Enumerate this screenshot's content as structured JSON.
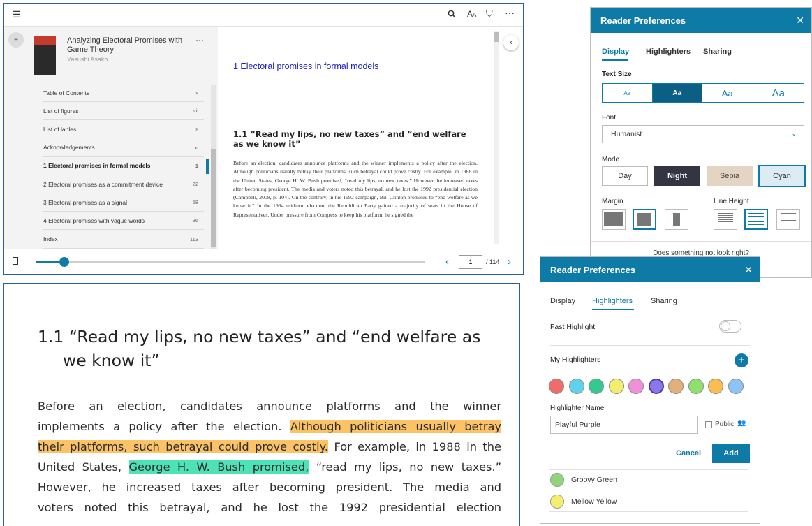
{
  "reader": {
    "book_title": "Analyzing Electoral Promises with Game Theory",
    "author": "Yasushi Asako",
    "toc": [
      {
        "label": "Table of Contents",
        "page": "v"
      },
      {
        "label": "List of figures",
        "page": "vii"
      },
      {
        "label": "List of lables",
        "page": "ix"
      },
      {
        "label": "Acknowledgements",
        "page": "xi"
      },
      {
        "label": "1 Electoral promises in formal models",
        "page": "1"
      },
      {
        "label": "2 Electoral promises as a commitment device",
        "page": "22"
      },
      {
        "label": "3 Electoral promises as a signal",
        "page": "58"
      },
      {
        "label": "4 Electoral promises with vague words",
        "page": "96"
      },
      {
        "label": "Index",
        "page": "113"
      }
    ],
    "active_toc_index": 4,
    "chapter_title": "1 Electoral promises in formal models",
    "section_title": "1.1 “Read my lips, no new taxes” and “end welfare as we know it”",
    "body_text": "Before an election, candidates announce platforms and the winner implements a policy after the election. Although politicians usually betray their platforms, such betrayal could prove costly. For example, in 1988 in the United States, George H. W. Bush promised, “read my lips, no new taxes.” However, he increased taxes after becoming president. The media and voters noted this betrayal, and he lost the 1992 presidential election (Campbell, 2008, p. 104). On the contrary, in his 1992 campaign, Bill Clinton promised to “end welfare as we know it.” In the 1994 midterm election, the Republican Party gained a majority of seats in the House of Representatives. Under pressure from Congress to keep his platform, he signed the",
    "page_current": "1",
    "page_total": "/ 114",
    "progress": 0.009,
    "icons": {
      "menu": "menu-lines-icon",
      "search": "search-icon",
      "text": "text-size-icon",
      "bookmark_add": "bookmark-star-icon",
      "more": "more-icon",
      "bookmark": "bookmark-icon"
    }
  },
  "zoom": {
    "heading_line1": "1.1 “Read my lips, no new taxes” and “end welfare as",
    "heading_line2": "we know it”",
    "l1": "Before an election, candidates announce platforms and the winner",
    "l2_a": "implements a policy after the election. ",
    "l2_b": "Although politicians usually betray",
    "l3_a": "their platforms, such betrayal could prove costly.",
    "l3_b": " For example, in 1988 in the",
    "l4_a": "United States, ",
    "l4_b": "George H. W. Bush promised,",
    "l4_c": " “read my lips, no new taxes.”",
    "l5": "However, he increased taxes after becoming president. The media and",
    "l6": "voters noted this betrayal, and he lost the 1992 presidential election",
    "colors": {
      "orange": "#fbc365",
      "green": "#4de3b7"
    }
  },
  "prefs_display": {
    "title": "Reader Preferences",
    "tabs": [
      "Display",
      "Highlighters",
      "Sharing"
    ],
    "text_size_label": "Text Size",
    "sizes": [
      "Aa",
      "Aa",
      "Aa",
      "Aa"
    ],
    "font_label": "Font",
    "font_value": "Humanist",
    "mode_label": "Mode",
    "modes": [
      "Day",
      "Night",
      "Sepia",
      "Cyan"
    ],
    "margin_label": "Margin",
    "line_height_label": "Line Height",
    "feedback": "Does something not look right?",
    "accent": "#0e7aa6"
  },
  "prefs_hl": {
    "title": "Reader Preferences",
    "tabs": [
      "Display",
      "Highlighters",
      "Sharing"
    ],
    "fast_label": "Fast Highlight",
    "my_label": "My Highlighters",
    "colors": [
      "#f26b6b",
      "#5fd3ee",
      "#34c98e",
      "#f4ee6f",
      "#f38ed8",
      "#8a78e6",
      "#e1b07b",
      "#8fe06c",
      "#fbbd4f",
      "#8dc4f5"
    ],
    "name_label": "Highlighter Name",
    "name_value": "Playful Purple",
    "public_label": "Public",
    "cancel": "Cancel",
    "add": "Add",
    "items": [
      {
        "name": "Groovy Green",
        "color": "#8fd67a"
      },
      {
        "name": "Mellow Yellow",
        "color": "#f4ee6f"
      }
    ]
  }
}
